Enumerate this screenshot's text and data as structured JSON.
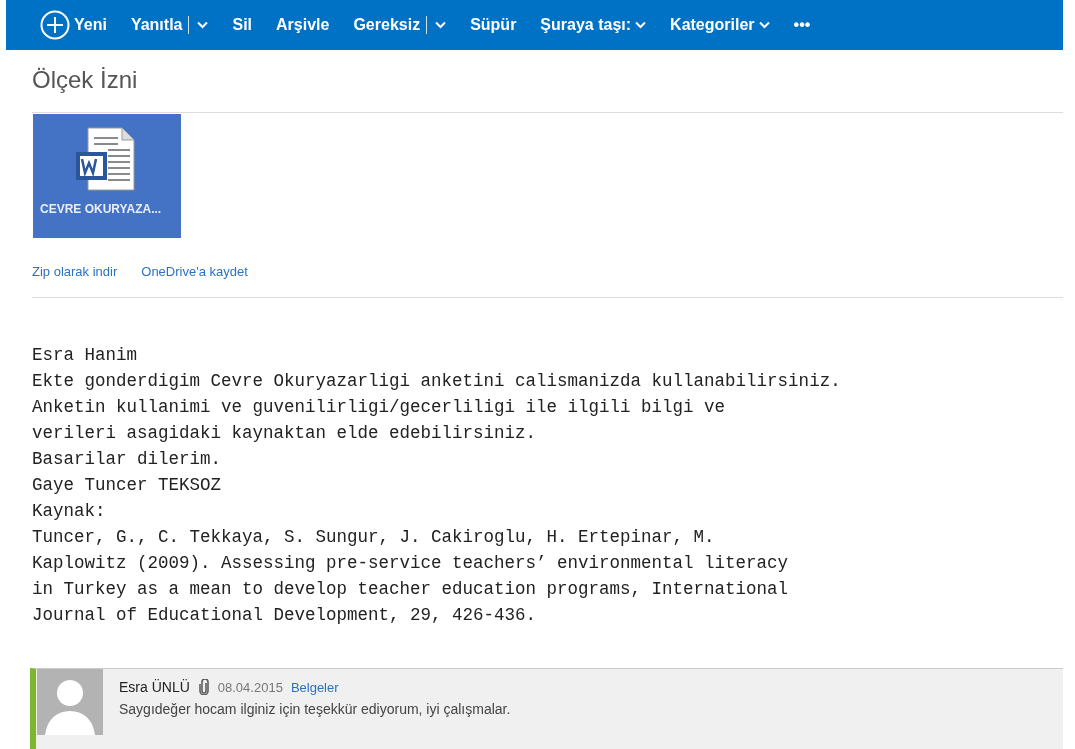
{
  "toolbar": {
    "items": [
      {
        "label": "Yeni",
        "kind": "new"
      },
      {
        "label": "Yanıtla",
        "kind": "split"
      },
      {
        "label": "Sil",
        "kind": "button"
      },
      {
        "label": "Arşivle",
        "kind": "button"
      },
      {
        "label": "Gereksiz",
        "kind": "split"
      },
      {
        "label": "Süpür",
        "kind": "button"
      },
      {
        "label": "Şuraya taşı:",
        "kind": "menu"
      },
      {
        "label": "Kategoriler",
        "kind": "menu"
      },
      {
        "label": "•••",
        "kind": "button"
      }
    ]
  },
  "subject": "Ölçek İzni",
  "attachment": {
    "name": "CEVRE OKURYAZA..."
  },
  "attachment_links": [
    "Zip olarak indir",
    "OneDrive'a kaydet"
  ],
  "body": [
    "Esra Hanim",
    "Ekte gonderdigim Cevre Okuryazarligi anketini calismanizda kullanabilirsiniz.",
    "Anketin kullanimi ve guvenilirligi/gecerliligi ile ilgili bilgi ve",
    "verileri asagidaki kaynaktan elde edebilirsiniz.",
    "Basarilar dilerim.",
    "Gaye Tuncer TEKSOZ",
    "Kaynak:",
    "Tuncer, G., C. Tekkaya, S. Sungur, J. Cakiroglu, H. Ertepinar, M.",
    "Kaplowitz (2009). Assessing pre-service teachers’ environmental literacy",
    "in Turkey as a mean to develop teacher education programs, International",
    "Journal of Educational Development, 29, 426-436."
  ],
  "reply": {
    "sender": "Esra ÜNLÜ",
    "has_attachment": true,
    "date": "08.04.2015",
    "folder": "Belgeler",
    "preview": "Saygıdeğer hocam ilginiz için teşekkür ediyorum, iyi çalışmalar.",
    "color": "#7cb82f"
  }
}
